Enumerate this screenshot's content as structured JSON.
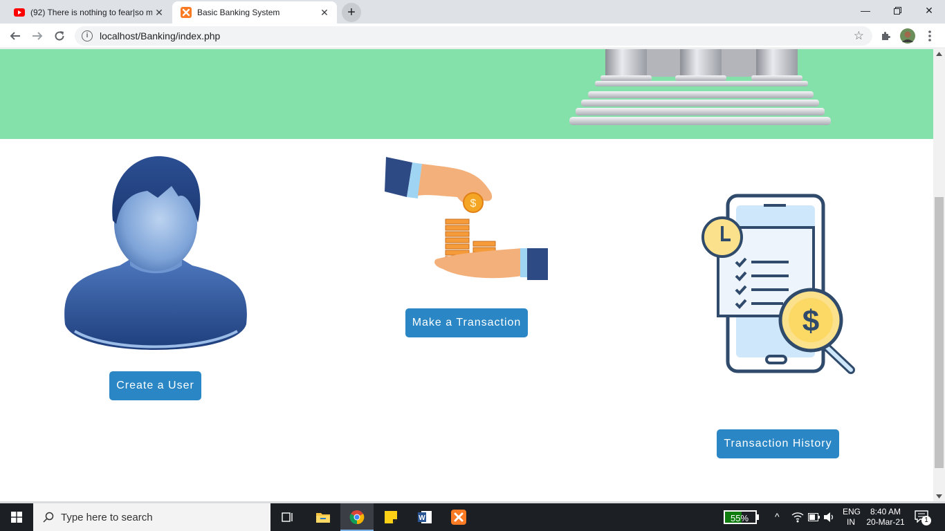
{
  "browser": {
    "tabs": [
      {
        "title": "(92) There is nothing to fear|so m",
        "favicon": "youtube-icon",
        "active": false
      },
      {
        "title": "Basic Banking System",
        "favicon": "xampp-icon",
        "active": true
      }
    ],
    "new_tab_label": "+",
    "url": "localhost/Banking/index.php"
  },
  "page": {
    "buttons": {
      "create_user": "Create a User",
      "make_transaction": "Make a Transaction",
      "transaction_history": "Transaction History"
    },
    "images": {
      "hero": "bank-building-illustration",
      "user": "user-avatar-illustration",
      "transaction": "hand-giving-coins-illustration",
      "history": "phone-checklist-dollar-illustration"
    },
    "colors": {
      "hero_bg": "#84e1a9",
      "button_bg": "#2a86c4",
      "button_text": "#ffffff"
    }
  },
  "taskbar": {
    "search_placeholder": "Type here to search",
    "battery_label": "55%",
    "language_top": "ENG",
    "language_bottom": "IN",
    "time": "8:40 AM",
    "date": "20-Mar-21",
    "notification_count": "1"
  }
}
